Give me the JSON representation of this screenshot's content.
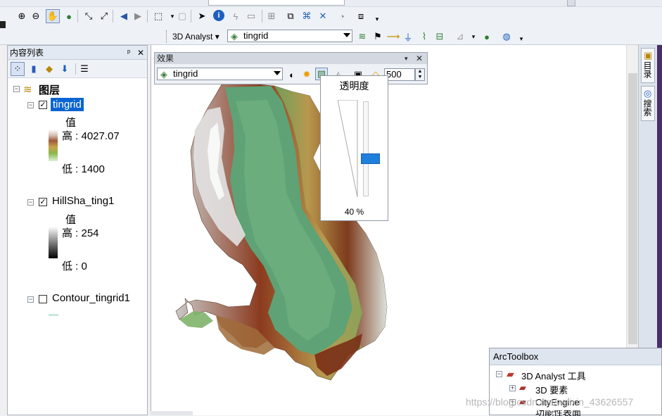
{
  "toolbar": {
    "analyst_label": "3D Analyst",
    "layer_combo": "tingrid"
  },
  "toc": {
    "title": "内容列表",
    "pin": "ᵖ",
    "close": "✕",
    "root_label": "图层",
    "layers": [
      {
        "name": "tingrid",
        "checked": true,
        "value_label": "值",
        "high_label": "高 : 4027.07",
        "low_label": "低 : 1400"
      },
      {
        "name": "HillSha_ting1",
        "checked": true,
        "value_label": "值",
        "high_label": "高 : 254",
        "low_label": "低 : 0"
      },
      {
        "name": "Contour_tingrid1",
        "checked": false
      }
    ]
  },
  "effects": {
    "title": "效果",
    "layer_combo": "tingrid",
    "flicker_value": "500",
    "popup_title": "透明度",
    "transparency_value": "40 %",
    "transparency_fraction": 0.4
  },
  "right_tabs": [
    "目录",
    "搜索"
  ],
  "arctoolbox": {
    "title": "ArcToolbox",
    "items": [
      "3D Analyst 工具",
      "3D 要素",
      "CityEngine",
      "功能性表面"
    ],
    "watermark": "https://blog.csdn.net/weixin_43626557"
  },
  "colors": {
    "selection": "#0a64d2",
    "slider_thumb": "#1f7fdc",
    "dem_low": "#5fa276",
    "dem_mid": "#b99a4e",
    "dem_high": "#8b3a1e"
  }
}
